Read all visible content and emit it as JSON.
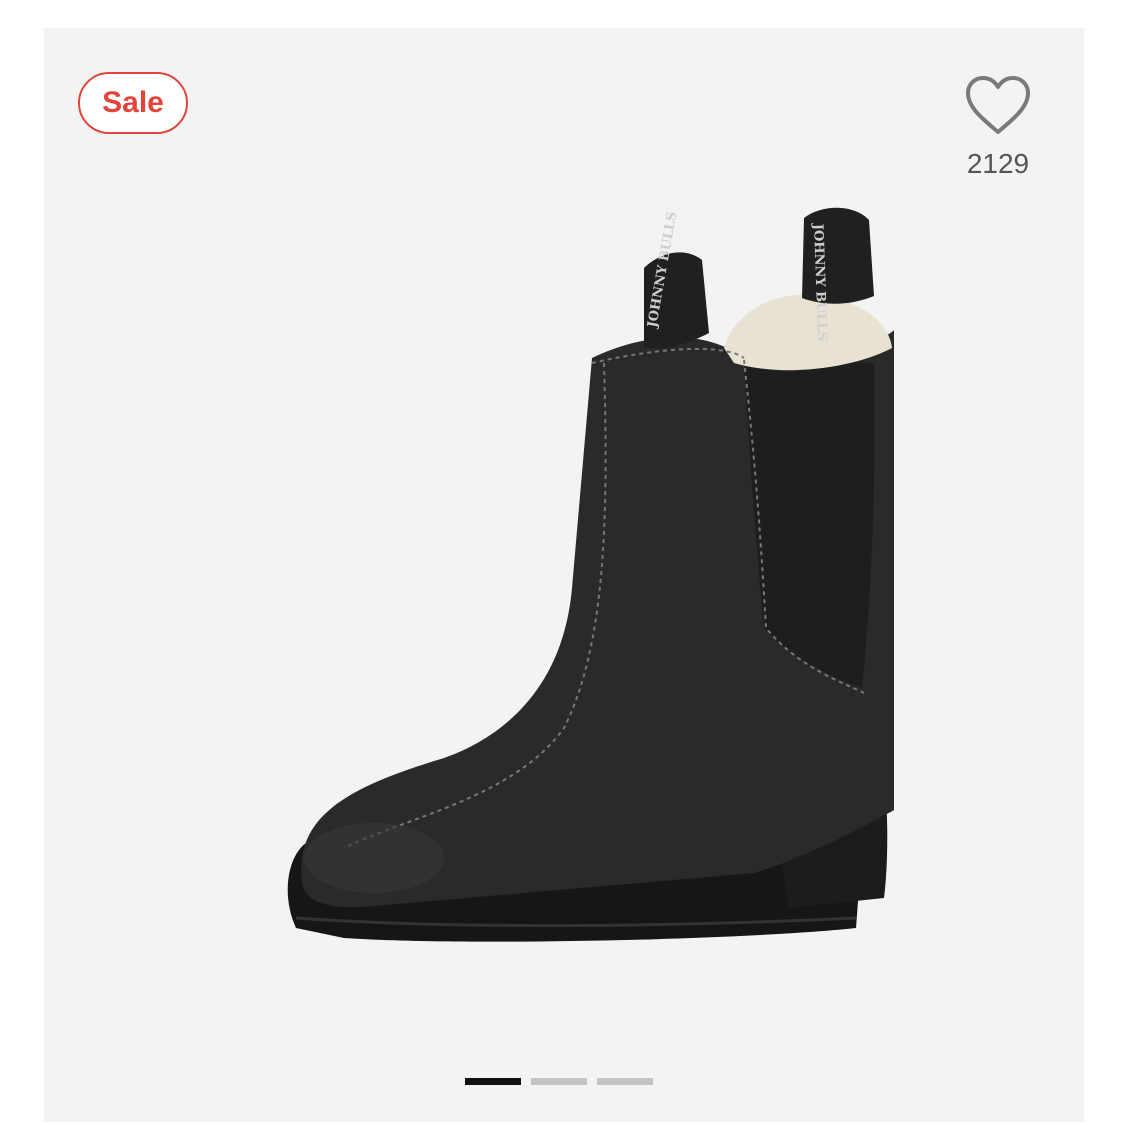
{
  "badge": {
    "label": "Sale",
    "color": "#e2433b"
  },
  "favorite": {
    "icon": "heart-outline-icon",
    "count": "2129"
  },
  "product_image": {
    "tab_text": "JOHNNY BULLS",
    "description": "black chelsea boot with shearling lining"
  },
  "carousel": {
    "total": 3,
    "active_index": 0
  }
}
